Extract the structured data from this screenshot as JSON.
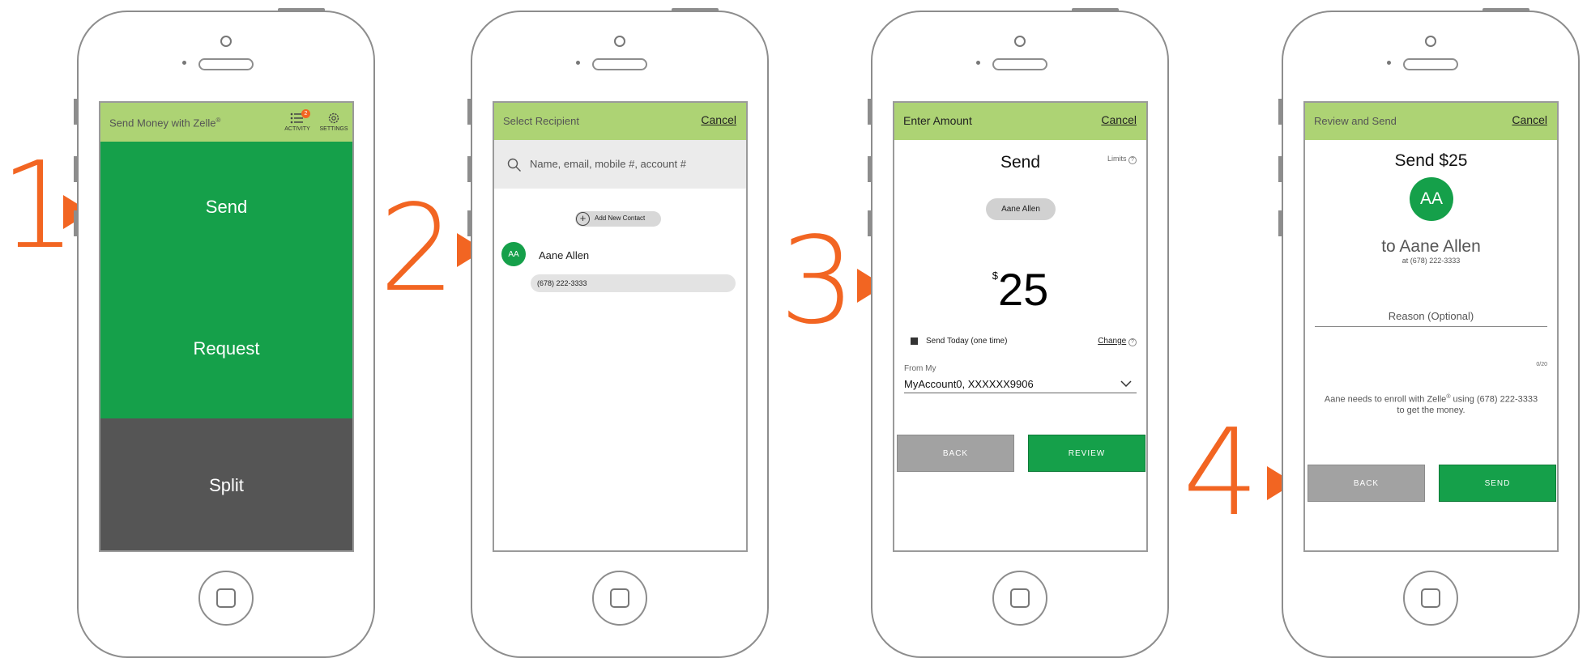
{
  "steps": [
    "1",
    "2",
    "3",
    "4"
  ],
  "screen1": {
    "title": "Send Money with Zelle",
    "title_sup": "®",
    "activity_label": "ACTIVITY",
    "activity_badge": "2",
    "settings_label": "SETTINGS",
    "tiles": [
      {
        "label": "Send",
        "color": "#15a04a"
      },
      {
        "label": "Request",
        "color": "#15a04a"
      },
      {
        "label": "Split",
        "color": "#555555"
      }
    ]
  },
  "screen2": {
    "title": "Select Recipient",
    "cancel": "Cancel",
    "search_placeholder": "Name, email, mobile #, account #",
    "add_contact": "Add New Contact",
    "contact_initials": "AA",
    "contact_name": "Aane Allen",
    "contact_phone": "(678) 222-3333"
  },
  "screen3": {
    "title": "Enter Amount",
    "cancel": "Cancel",
    "heading": "Send",
    "limits": "Limits",
    "recipient_chip": "Aane Allen",
    "currency": "$",
    "amount": "25",
    "schedule": "Send Today (one time)",
    "change": "Change",
    "from_label": "From My",
    "account": "MyAccount0, XXXXXX9906",
    "back": "BACK",
    "review": "REVIEW"
  },
  "screen4": {
    "title": "Review and Send",
    "cancel": "Cancel",
    "heading": "Send $25",
    "initials": "AA",
    "to_name": "to Aane Allen",
    "at_phone": "at (678) 222-3333",
    "reason_placeholder": "Reason (Optional)",
    "counter": "0/20",
    "note_pre": "Aane needs to enroll with Zelle",
    "note_sup": "®",
    "note_post": " using (678) 222-3333 to get the money.",
    "back": "BACK",
    "send": "SEND"
  },
  "colors": {
    "accent": "#f26522",
    "header": "#add374",
    "green": "#15a04a",
    "dark": "#555555"
  }
}
